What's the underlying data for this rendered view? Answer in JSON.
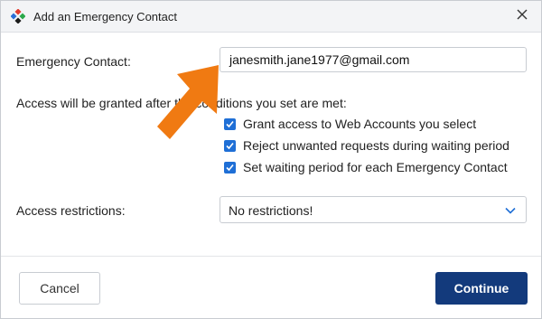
{
  "dialog": {
    "title": "Add an Emergency Contact",
    "icon": "app-logo-icon",
    "close_icon": "close-icon"
  },
  "form": {
    "contact_label": "Emergency Contact:",
    "contact_value": "janesmith.jane1977@gmail.com",
    "conditions_text": "Access will be granted after the conditions you set are met:",
    "checkboxes": [
      {
        "label": "Grant access to Web Accounts you select",
        "checked": true
      },
      {
        "label": "Reject unwanted requests during waiting period",
        "checked": true
      },
      {
        "label": "Set waiting period for each Emergency Contact",
        "checked": true
      }
    ],
    "restrictions_label": "Access restrictions:",
    "restrictions_value": "No restrictions!"
  },
  "footer": {
    "cancel_label": "Cancel",
    "continue_label": "Continue"
  },
  "colors": {
    "accent": "#1f6fd6",
    "primary_button": "#133a7c",
    "annotation_arrow": "#f07a12"
  }
}
